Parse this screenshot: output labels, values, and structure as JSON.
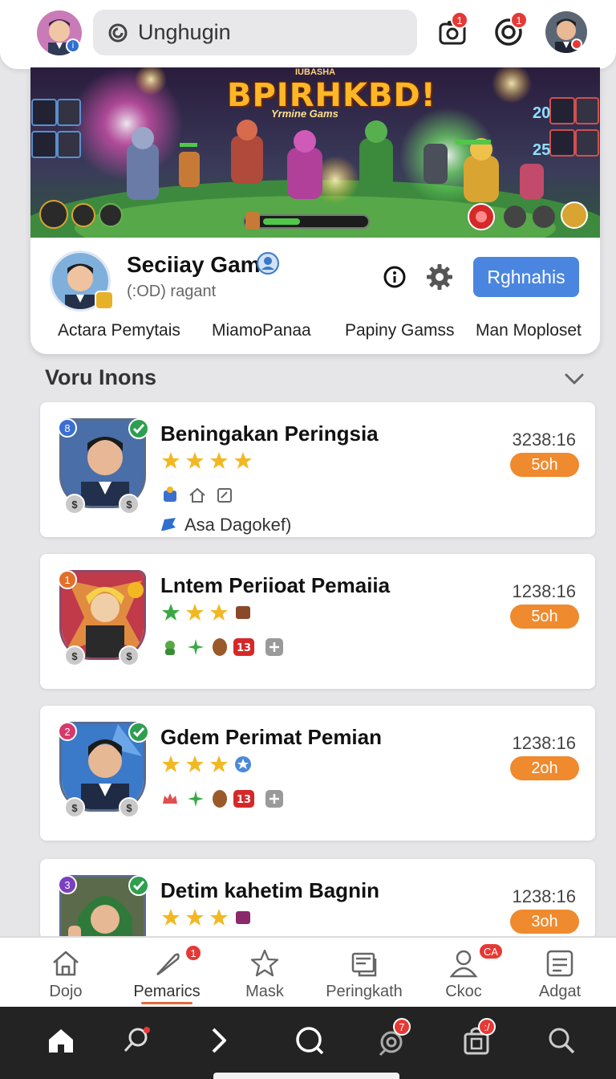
{
  "header": {
    "search_text": "Unghugin",
    "notification_count_1": "1",
    "notification_count_2": "1"
  },
  "banner": {
    "kicker": "IUBASHA",
    "title": "BPIRHKBD!",
    "subtitle": "Yrmine Gams",
    "score_top": "20",
    "score_bottom": "25"
  },
  "profile": {
    "name": "Seciiay Gam",
    "subtitle": "(:OD) ragant",
    "action_button": "Rghnahis",
    "links": [
      "Actara Pemytais",
      "MiamoPanaa",
      "Papiny Gamss",
      "Man Moploset"
    ]
  },
  "section": {
    "title": "Voru Inons"
  },
  "list": [
    {
      "rank": "8",
      "rank_color": "#3a6fd1",
      "title": "Beningakan Peringsia",
      "time": "3238:16",
      "pill": "5oh",
      "note": "Asa Dagokef)",
      "stars": 4
    },
    {
      "rank": "1",
      "rank_color": "#e0702c",
      "title": "Lntem Periioat Pemaiia",
      "time": "1238:16",
      "pill": "5oh",
      "note": "",
      "stars": 3
    },
    {
      "rank": "2",
      "rank_color": "#d63a6a",
      "title": "Gdem Perimat Pemian",
      "time": "1238:16",
      "pill": "2oh",
      "note": "",
      "stars": 3
    },
    {
      "rank": "3",
      "rank_color": "#7b3fc0",
      "title": "Detim kahetim Bagnin",
      "time": "1238:16",
      "pill": "3oh",
      "note": "",
      "stars": 3
    }
  ],
  "bottom_nav": {
    "items": [
      {
        "label": "Dojo",
        "icon": "home-outline-icon"
      },
      {
        "label": "Pemarics",
        "icon": "feather-icon",
        "badge": "1"
      },
      {
        "label": "Mask",
        "icon": "star-icon"
      },
      {
        "label": "Peringkath",
        "icon": "card-icon"
      },
      {
        "label": "Ckoc",
        "icon": "person-icon",
        "badge": "CA"
      },
      {
        "label": "Adgat",
        "icon": "list-icon"
      }
    ]
  },
  "system_bar": {
    "badge_1": "7",
    "badge_2": ":/"
  },
  "colors": {
    "accent_blue": "#4a86e0",
    "accent_orange": "#ef8a2f",
    "badge_red": "#e53935",
    "star_gold": "#f2b824"
  }
}
